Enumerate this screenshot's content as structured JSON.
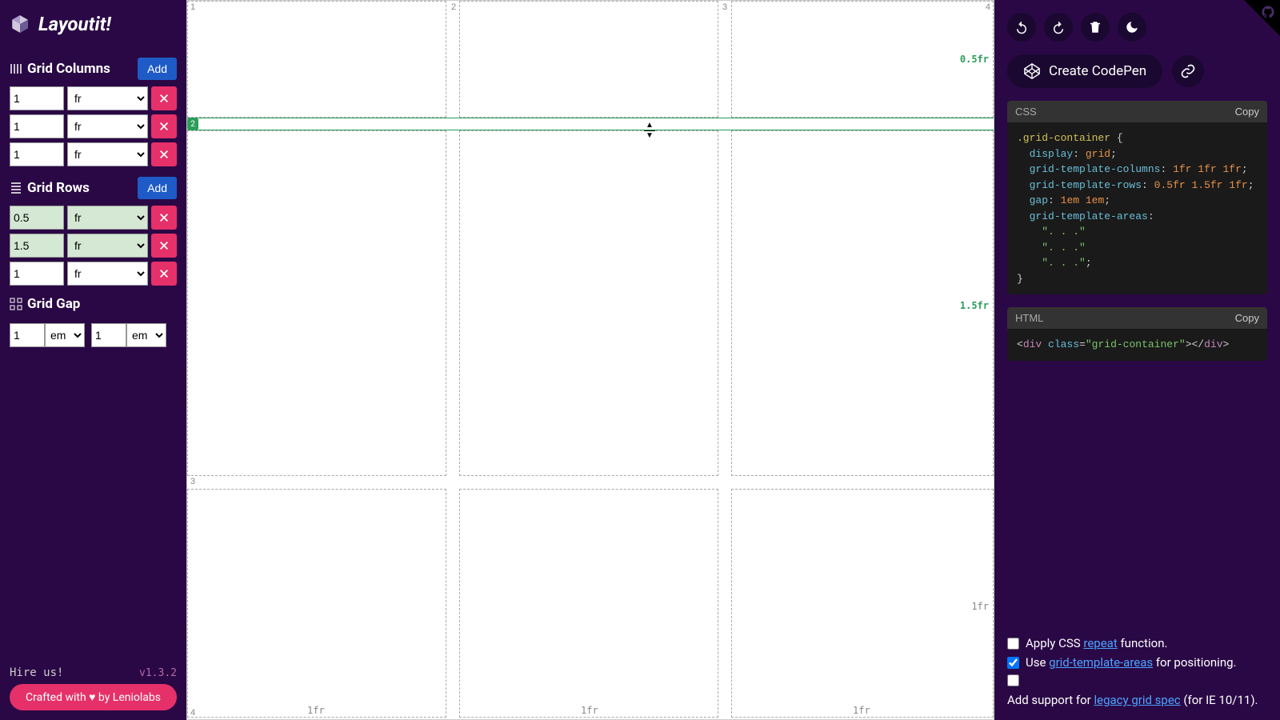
{
  "brand": "Layoutit!",
  "sidebar": {
    "columns_title": "Grid Columns",
    "rows_title": "Grid Rows",
    "gap_title": "Grid Gap",
    "add_label": "Add",
    "columns": [
      {
        "value": "1",
        "unit": "fr"
      },
      {
        "value": "1",
        "unit": "fr"
      },
      {
        "value": "1",
        "unit": "fr"
      }
    ],
    "rows": [
      {
        "value": "0.5",
        "unit": "fr",
        "highlight": true
      },
      {
        "value": "1.5",
        "unit": "fr",
        "highlight": true
      },
      {
        "value": "1",
        "unit": "fr"
      }
    ],
    "gap": {
      "row_value": "1",
      "row_unit": "em",
      "col_value": "1",
      "col_unit": "em"
    },
    "hire_us": "Hire us!",
    "version": "v1.3.2",
    "crafted": "Crafted with ♥ by Leniolabs"
  },
  "canvas": {
    "col_nums": [
      "1",
      "2",
      "3",
      "4"
    ],
    "row_nums_right": [
      "1",
      "2",
      "3",
      "4"
    ],
    "col_labels": [
      "1fr",
      "1fr",
      "1fr"
    ],
    "row_labels": [
      "0.5fr",
      "1.5fr",
      "1fr"
    ],
    "active_band_num": "2"
  },
  "right": {
    "create_codepen": "Create CodePen",
    "css_label": "CSS",
    "html_label": "HTML",
    "copy_label": "Copy",
    "options": {
      "apply_before": "Apply CSS ",
      "apply_link": "repeat",
      "apply_after": " function.",
      "use_before": "Use ",
      "use_link": "grid-template-areas",
      "use_after": " for positioning.",
      "legacy_before": "Add support for ",
      "legacy_link": "legacy grid spec",
      "legacy_after": " (for IE 10/11).",
      "apply_checked": false,
      "use_checked": true,
      "legacy_checked": false
    }
  }
}
